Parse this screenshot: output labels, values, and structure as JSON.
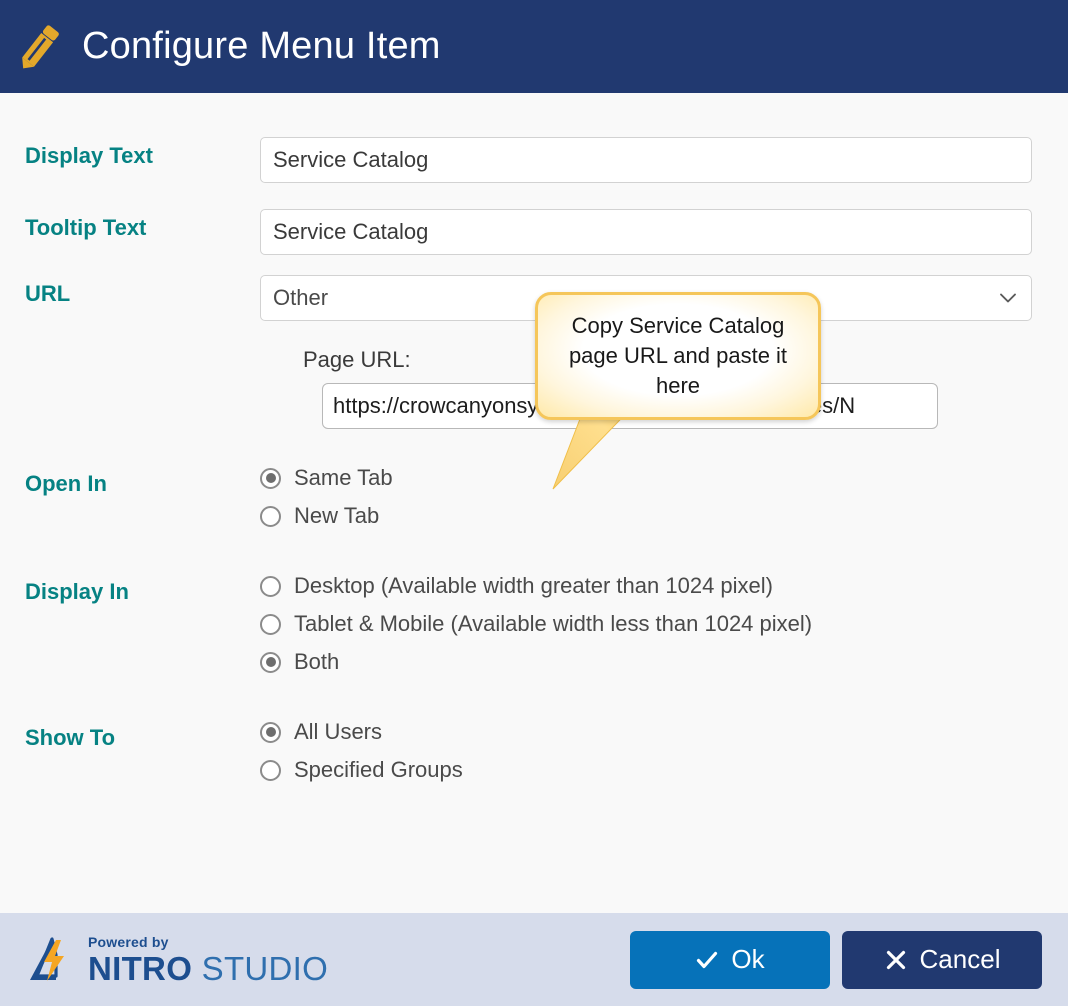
{
  "header": {
    "title": "Configure Menu Item",
    "icon": "pencil-icon",
    "background_color": "#213970",
    "title_color": "#ffffff",
    "icon_color": "#e3a82b"
  },
  "theme": {
    "label_color": "#068283",
    "body_background": "#f9f9f9",
    "footer_background": "#d6dceb",
    "ok_button_color": "#0672b9",
    "cancel_button_color": "#213970",
    "callout_border_color": "#f5c65a"
  },
  "form": {
    "display_text": {
      "label": "Display Text",
      "value": "Service Catalog",
      "placeholder": ""
    },
    "tooltip_text": {
      "label": "Tooltip Text",
      "value": "Service Catalog",
      "placeholder": ""
    },
    "url": {
      "label": "URL",
      "selected": "Other",
      "options": [
        "Other"
      ]
    },
    "page_url": {
      "label": "Page URL:",
      "value": "https://crowcanyonsystemsinc.sharepoint.com/sites/N",
      "placeholder": ""
    },
    "open_in": {
      "label": "Open In",
      "options": [
        {
          "label": "Same Tab",
          "checked": true
        },
        {
          "label": "New Tab",
          "checked": false
        }
      ]
    },
    "display_in": {
      "label": "Display In",
      "options": [
        {
          "label": "Desktop (Available width greater than 1024 pixel)",
          "checked": false
        },
        {
          "label": "Tablet & Mobile (Available width less than 1024 pixel)",
          "checked": false
        },
        {
          "label": "Both",
          "checked": true
        }
      ]
    },
    "show_to": {
      "label": "Show To",
      "options": [
        {
          "label": "All Users",
          "checked": true
        },
        {
          "label": "Specified Groups",
          "checked": false
        }
      ]
    }
  },
  "callout": {
    "text": "Copy Service Catalog page URL and paste it here"
  },
  "footer": {
    "brand": {
      "powered_by": "Powered by",
      "name_bold": "NITRO",
      "name_regular": "STUDIO",
      "logo_icon": "nitro-bolt-logo"
    },
    "buttons": {
      "ok": {
        "label": "Ok",
        "icon": "check-icon"
      },
      "cancel": {
        "label": "Cancel",
        "icon": "x-icon"
      }
    }
  }
}
